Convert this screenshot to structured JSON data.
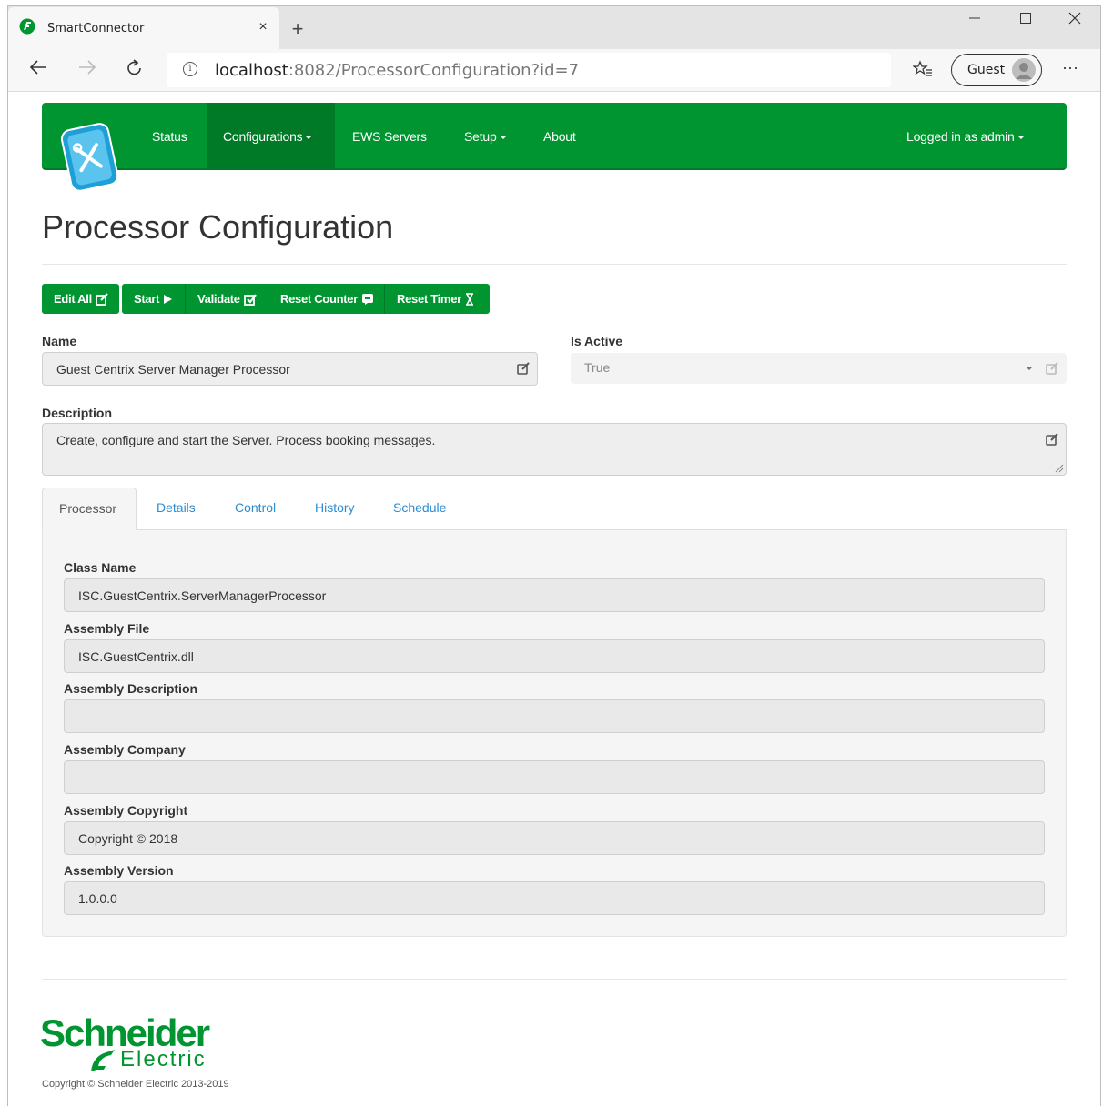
{
  "browser": {
    "tab_title": "SmartConnector",
    "tab_close": "×",
    "new_tab": "+",
    "url_host": "localhost",
    "url_path": ":8082/ProcessorConfiguration?id=7",
    "info": "i",
    "profile_label": "Guest",
    "more": "···",
    "icons": [
      "back-arrow-icon",
      "forward-arrow-icon",
      "refresh-icon",
      "info-icon",
      "favorites-icon",
      "more-icon"
    ]
  },
  "navbar": {
    "items": [
      {
        "label": "Status",
        "active": false,
        "caret": false
      },
      {
        "label": "Configurations",
        "active": true,
        "caret": true
      },
      {
        "label": "EWS Servers",
        "active": false,
        "caret": false
      },
      {
        "label": "Setup",
        "active": false,
        "caret": true
      },
      {
        "label": "About",
        "active": false,
        "caret": false
      }
    ],
    "user": "Logged in as admin"
  },
  "page": {
    "title": "Processor Configuration"
  },
  "toolbar": {
    "edit_all": "Edit All",
    "start": "Start",
    "validate": "Validate",
    "reset_counter": "Reset Counter",
    "reset_timer": "Reset Timer"
  },
  "form": {
    "name_label": "Name",
    "name_value": "Guest Centrix Server Manager Processor",
    "active_label": "Is Active",
    "active_value": "True",
    "description_label": "Description",
    "description_value": "Create, configure and start the Server. Process booking messages."
  },
  "tabs": [
    "Processor",
    "Details",
    "Control",
    "History",
    "Schedule"
  ],
  "processor": {
    "fields": [
      {
        "label": "Class Name",
        "value": "ISC.GuestCentrix.ServerManagerProcessor"
      },
      {
        "label": "Assembly File",
        "value": "ISC.GuestCentrix.dll"
      },
      {
        "label": "Assembly Description",
        "value": ""
      },
      {
        "label": "Assembly Company",
        "value": ""
      },
      {
        "label": "Assembly Copyright",
        "value": "Copyright © 2018"
      },
      {
        "label": "Assembly Version",
        "value": "1.0.0.0"
      }
    ]
  },
  "footer": {
    "brand_top": "Schneider",
    "brand_bottom": "Electric",
    "copyright": "Copyright © Schneider Electric 2013-2019"
  },
  "colors": {
    "brand_green": "#009530",
    "brand_green_dark": "#007a27",
    "link_blue": "#2a8dd4"
  }
}
